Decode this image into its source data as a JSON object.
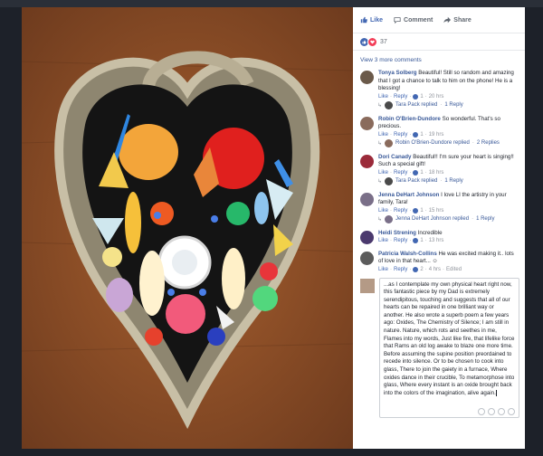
{
  "actions": {
    "like": "Like",
    "comment": "Comment",
    "share": "Share"
  },
  "reactions": {
    "count": "37"
  },
  "view_more": "View 3 more comments",
  "comments": [
    {
      "name": "Tonya Solberg",
      "text": "Beautiful! Still so random and amazing that I got a chance to talk to him on the phone! He is a blessing!",
      "like": "Like",
      "reply": "Reply",
      "likes": "1",
      "time": "20 hrs",
      "reply_summary": {
        "author": "Tara Pack",
        "text": "Tara Pack replied",
        "sep": "·",
        "count": "1 Reply"
      },
      "avatar_color": "#6b5a4a"
    },
    {
      "name": "Robin O'Brien-Dundore",
      "text": "So wonderful. That's so precious.",
      "like": "Like",
      "reply": "Reply",
      "likes": "1",
      "time": "19 hrs",
      "reply_summary": {
        "author": "Robin O'Brien-Dundore",
        "text": "Robin O'Brien-Dundore replied",
        "sep": "·",
        "count": "2 Replies"
      },
      "avatar_color": "#8a6b5c"
    },
    {
      "name": "Dori Canady",
      "text": "Beautiful!! I'm sure your heart is singing!! Such a special gift!",
      "like": "Like",
      "reply": "Reply",
      "likes": "1",
      "time": "18 hrs",
      "reply_summary": {
        "author": "Tara Pack",
        "text": "Tara Pack replied",
        "sep": "·",
        "count": "1 Reply"
      },
      "avatar_color": "#9b2b3a"
    },
    {
      "name": "Jenna DeHart Johnson",
      "text": "I love LI the artistry in your family, Tara!",
      "like": "Like",
      "reply": "Reply",
      "likes": "1",
      "time": "15 hrs",
      "reply_summary": {
        "author": "Jenna DeHart Johnson",
        "text": "Jenna DeHart Johnson replied",
        "sep": "·",
        "count": "1 Reply"
      },
      "avatar_color": "#7a6f88"
    },
    {
      "name": "Heidi Strening",
      "text": "Incredible",
      "like": "Like",
      "reply": "Reply",
      "likes": "1",
      "time": "13 hrs",
      "avatar_color": "#4b3a6e"
    },
    {
      "name": "Patricia Walsh-Collins",
      "text": "He was excited making it.. lots of love in that heart...",
      "like": "Like",
      "reply": "Reply",
      "likes": "2",
      "time": "4 hrs",
      "edited": "Edited",
      "avatar_color": "#5c5c5c"
    }
  ],
  "composer": {
    "text": "...as I contemplate my own physical heart right now, this fantastic piece by my Dad is extremely serendipitous, touching and suggests that all of our hearts can be repaired in one brilliant way or another.  He also wrote a superb poem a few years ago: Oxides, The Chemistry of Silence; I am still in nature. Nature, which rots and seethes in me, Flames into my words, Just like fire, that lifelike force that Rams an old log awake to blaze one more time. Before assuming the supine position preordained to recede into silence.   Or to be chosen to cook into glass, There to join the gaiety in a furnace, Where oxides dance in their crucible, To metamorphose into glass, Where every instant is an oxide brought back into the colors of the imagination, alive again."
  },
  "colors": {
    "brand": "#4267b2",
    "link": "#385898",
    "meta": "#90949c",
    "frame": "#a39a84"
  },
  "icons": [
    "like-icon",
    "comment-icon",
    "share-icon",
    "love-reaction-icon",
    "reply-arrow-icon"
  ]
}
